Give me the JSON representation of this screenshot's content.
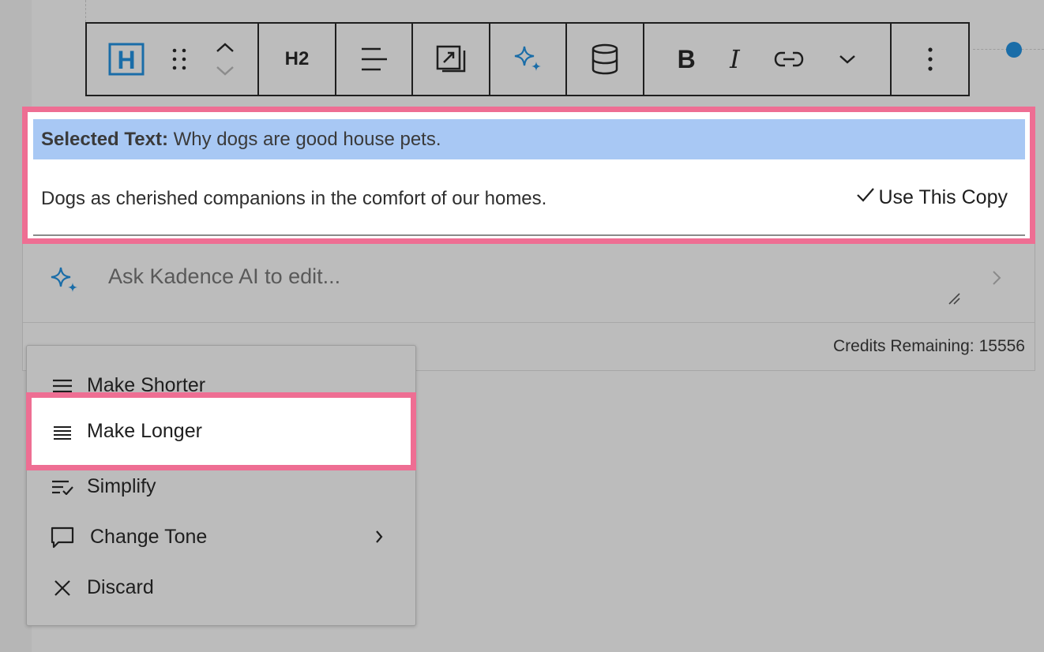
{
  "colors": {
    "accent": "#1a6da8",
    "highlight_border": "#ee6e93",
    "selection_bg": "#a8c8f4"
  },
  "toolbar": {
    "heading_block_icon": "heading-block-icon",
    "heading_level_label": "H2",
    "bold_label": "B",
    "italic_label": "I"
  },
  "selection": {
    "prefix": "Selected Text:",
    "text": "Why dogs are good house pets.",
    "result": "Dogs as cherished companions in the comfort of our homes.",
    "use_copy_label": "Use This Copy"
  },
  "ai_prompt": {
    "placeholder": "Ask Kadence AI to edit...",
    "credits_label": "Credits Remaining:",
    "credits_value": "15556"
  },
  "menu": {
    "items": [
      {
        "label": "Make Shorter",
        "icon": "align-lines-icon"
      },
      {
        "label": "Make Longer",
        "icon": "justify-lines-icon"
      },
      {
        "label": "Simplify",
        "icon": "list-check-icon"
      },
      {
        "label": "Change Tone",
        "icon": "speech-bubble-icon"
      },
      {
        "label": "Discard",
        "icon": "close-icon"
      }
    ]
  }
}
